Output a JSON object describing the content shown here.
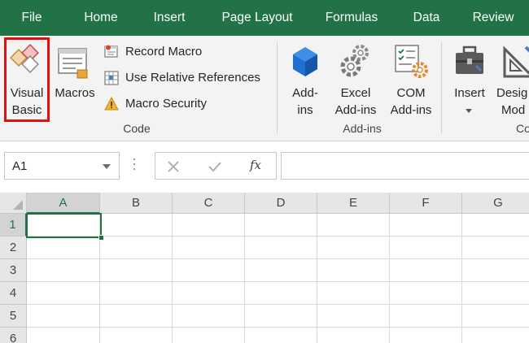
{
  "tabs": [
    "File",
    "Home",
    "Insert",
    "Page Layout",
    "Formulas",
    "Data",
    "Review"
  ],
  "ribbon": {
    "code_group": {
      "visual_basic": {
        "line1": "Visual",
        "line2": "Basic"
      },
      "macros": "Macros",
      "record_macro": "Record Macro",
      "use_relative_references": "Use Relative References",
      "macro_security": "Macro Security",
      "label": "Code"
    },
    "addins_group": {
      "add_ins": {
        "line1": "Add-",
        "line2": "ins"
      },
      "excel_add_ins": {
        "line1": "Excel",
        "line2": "Add-ins"
      },
      "com_add_ins": {
        "line1": "COM",
        "line2": "Add-ins"
      },
      "label": "Add-ins"
    },
    "controls_group": {
      "insert": "Insert",
      "design_mode": {
        "line1": "Desig",
        "line2": "Mod"
      },
      "label_partial": "Co"
    }
  },
  "formula_bar": {
    "name_box": "A1",
    "fx": "fx",
    "formula": ""
  },
  "sheet": {
    "columns": [
      "A",
      "B",
      "C",
      "D",
      "E",
      "F",
      "G"
    ],
    "rows": [
      "1",
      "2",
      "3",
      "4",
      "5",
      "6"
    ],
    "selected_cell": "A1"
  },
  "colors": {
    "brand_green": "#217346",
    "highlight_red": "#e01010"
  }
}
